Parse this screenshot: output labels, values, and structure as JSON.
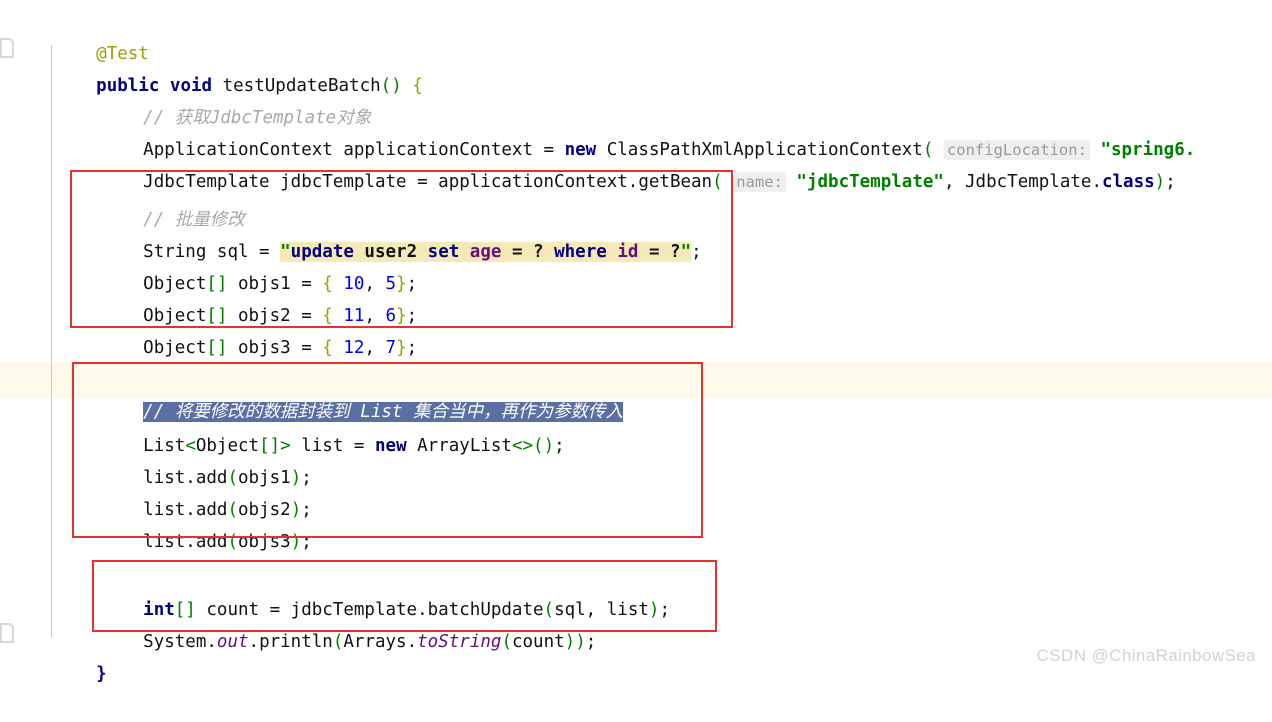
{
  "editor": {
    "watermark": "CSDN @ChinaRainbowSea",
    "highlight_color": "#fffaea",
    "annotation_box_color": "#e8312b",
    "selection_color": "#5a6fa3",
    "sql_highlight_color": "#f5e9b8",
    "indent_guide_color": "#bcc7d4"
  },
  "code": {
    "line01": {
      "annotation": "@Test"
    },
    "line02": {
      "kw_public": "public",
      "kw_void": "void",
      "method": " testUpdateBatch",
      "paren_open": "(",
      "paren_close": ")",
      "brace_open": " {"
    },
    "line03": {
      "comment": "// 获取JdbcTemplate对象"
    },
    "line04": {
      "type": "ApplicationContext applicationContext = ",
      "kw_new": "new",
      "ctor": " ClassPathXmlApplicationContext",
      "paren_open": "(",
      "hint": "configLocation:",
      "string": "\"spring6."
    },
    "line05": {
      "type": "JdbcTemplate jdbcTemplate = applicationContext.getBean",
      "paren_open": "(",
      "hint": "name:",
      "string": "\"jdbcTemplate\"",
      "comma": ", ",
      "classref": "JdbcTemplate.",
      "kw_class": "class",
      "paren_close": ")",
      "semi": ";"
    },
    "line06": {
      "comment": "// 批量修改"
    },
    "line07": {
      "prefix": "String sql = ",
      "quote_open": "\"",
      "sql_update": "update",
      "sql_table": " user2 ",
      "sql_set": "set",
      "sql_age": " age ",
      "sql_eq1": "= ? ",
      "sql_where": "where",
      "sql_id": " id ",
      "sql_eq2": "= ?",
      "quote_close": "\"",
      "semi": ";"
    },
    "line08": {
      "type": "Object",
      "bracket": "[]",
      "name": " objs1 = ",
      "brace_open": "{",
      "v1": " 10",
      "comma": ", ",
      "v2": "5",
      "brace_close": "}",
      "semi": ";"
    },
    "line09": {
      "type": "Object",
      "bracket": "[]",
      "name": " objs2 = ",
      "brace_open": "{",
      "v1": " 11",
      "comma": ", ",
      "v2": "6",
      "brace_close": "}",
      "semi": ";"
    },
    "line10": {
      "type": "Object",
      "bracket": "[]",
      "name": " objs3 = ",
      "brace_open": "{",
      "v1": " 12",
      "comma": ", ",
      "v2": "7",
      "brace_close": "}",
      "semi": ";"
    },
    "line11": {
      "comment_selected": "// 将要修改的数据封装到 List 集合当中，再作为参数传入"
    },
    "line12": {
      "type": "List",
      "angle_open": "<",
      "generic": "Object",
      "bracket": "[]",
      "angle_close": ">",
      "name": " list = ",
      "kw_new": "new",
      "ctor": " ArrayList",
      "diamond": "<>",
      "paren": "()",
      "semi": ";"
    },
    "line13": {
      "call": "list.add",
      "paren_open": "(",
      "arg": "objs1",
      "paren_close": ")",
      "semi": ";"
    },
    "line14": {
      "call": "list.add",
      "paren_open": "(",
      "arg": "objs2",
      "paren_close": ")",
      "semi": ";"
    },
    "line15": {
      "call": "list.add",
      "paren_open": "(",
      "arg": "objs3",
      "paren_close": ")",
      "semi": ";"
    },
    "line16": {
      "kw_int": "int",
      "bracket": "[]",
      "name": " count = jdbcTemplate.batchUpdate",
      "paren_open": "(",
      "args": "sql, list",
      "paren_close": ")",
      "semi": ";"
    },
    "line17": {
      "sys": "System.",
      "out": "out",
      "println": ".println",
      "paren_open": "(",
      "arrays": "Arrays.",
      "tostring": "toString",
      "paren_open2": "(",
      "arg": "count",
      "paren_close2": ")",
      "paren_close": ")",
      "semi": ";"
    },
    "line18": {
      "brace_close": "}"
    }
  },
  "annotations": {
    "box1_label": "batch-params-box",
    "box2_label": "list-wrapping-box",
    "box3_label": "batch-update-call-box"
  }
}
